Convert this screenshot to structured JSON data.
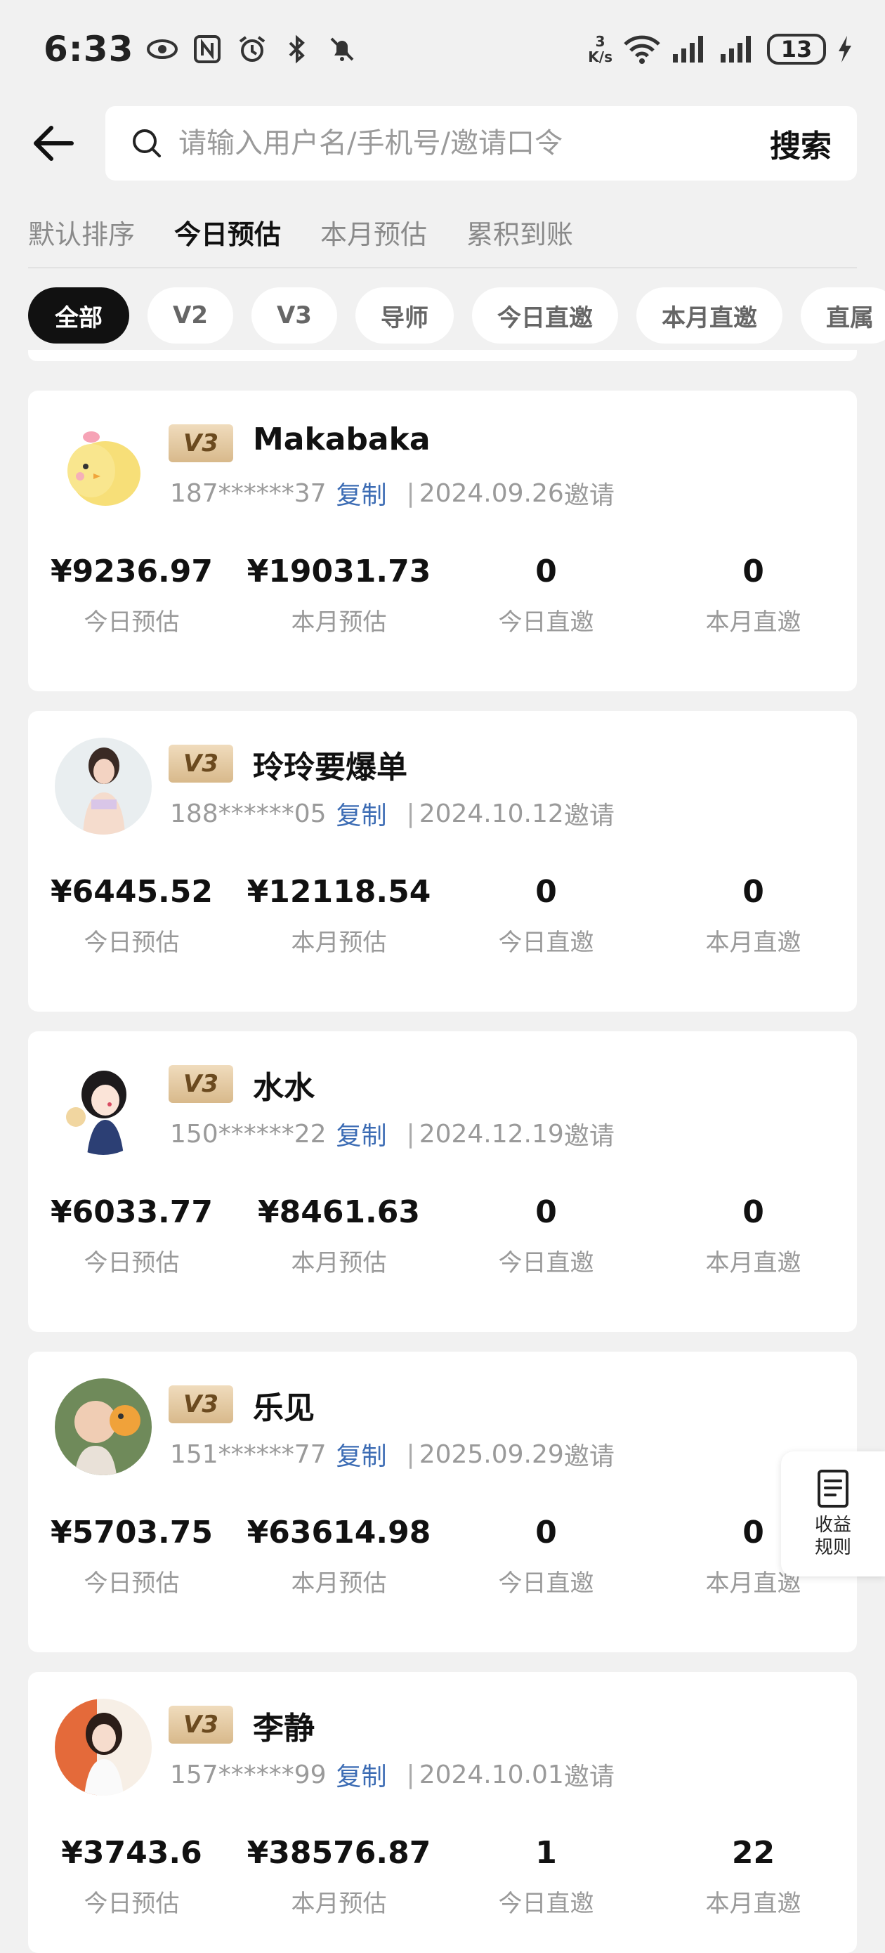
{
  "status_bar": {
    "time": "6:33",
    "net_speed_value": "3",
    "net_speed_unit": "K/s",
    "battery": "13"
  },
  "search": {
    "placeholder": "请输入用户名/手机号/邀请口令",
    "button_label": "搜索"
  },
  "sort_tabs": [
    {
      "label": "默认排序",
      "active": false
    },
    {
      "label": "今日预估",
      "active": true
    },
    {
      "label": "本月预估",
      "active": false
    },
    {
      "label": "累积到账",
      "active": false
    }
  ],
  "filter_chips": [
    {
      "label": "全部",
      "active": true
    },
    {
      "label": "V2",
      "active": false
    },
    {
      "label": "V3",
      "active": false
    },
    {
      "label": "导师",
      "active": false
    },
    {
      "label": "今日直邀",
      "active": false
    },
    {
      "label": "本月直邀",
      "active": false
    },
    {
      "label": "直属",
      "active": false
    }
  ],
  "copy_label": "复制",
  "invite_suffix": "邀请",
  "stat_labels": [
    "今日预估",
    "本月预估",
    "今日直邀",
    "本月直邀"
  ],
  "members": [
    {
      "level": "V3",
      "name": "Makabaka",
      "phone": "187******37",
      "date": "2024.09.26",
      "today_est": "¥9236.97",
      "month_est": "¥19031.73",
      "today_direct": "0",
      "month_direct": "0",
      "avatar": "chick"
    },
    {
      "level": "V3",
      "name": "玲玲要爆单",
      "phone": "188******05",
      "date": "2024.10.12",
      "today_est": "¥6445.52",
      "month_est": "¥12118.54",
      "today_direct": "0",
      "month_direct": "0",
      "avatar": "woman"
    },
    {
      "level": "V3",
      "name": "水水",
      "phone": "150******22",
      "date": "2024.12.19",
      "today_est": "¥6033.77",
      "month_est": "¥8461.63",
      "today_direct": "0",
      "month_direct": "0",
      "avatar": "cartoon-girl"
    },
    {
      "level": "V3",
      "name": "乐见",
      "phone": "151******77",
      "date": "2025.09.29",
      "today_est": "¥5703.75",
      "month_est": "¥63614.98",
      "today_direct": "0",
      "month_direct": "0",
      "avatar": "child"
    },
    {
      "level": "V3",
      "name": "李静",
      "phone": "157******99",
      "date": "2024.10.01",
      "today_est": "¥3743.6",
      "month_est": "¥38576.87",
      "today_direct": "1",
      "month_direct": "22",
      "avatar": "woman-red"
    }
  ],
  "float_button": {
    "label_line1": "收益",
    "label_line2": "规则",
    "icon": "document-icon"
  }
}
